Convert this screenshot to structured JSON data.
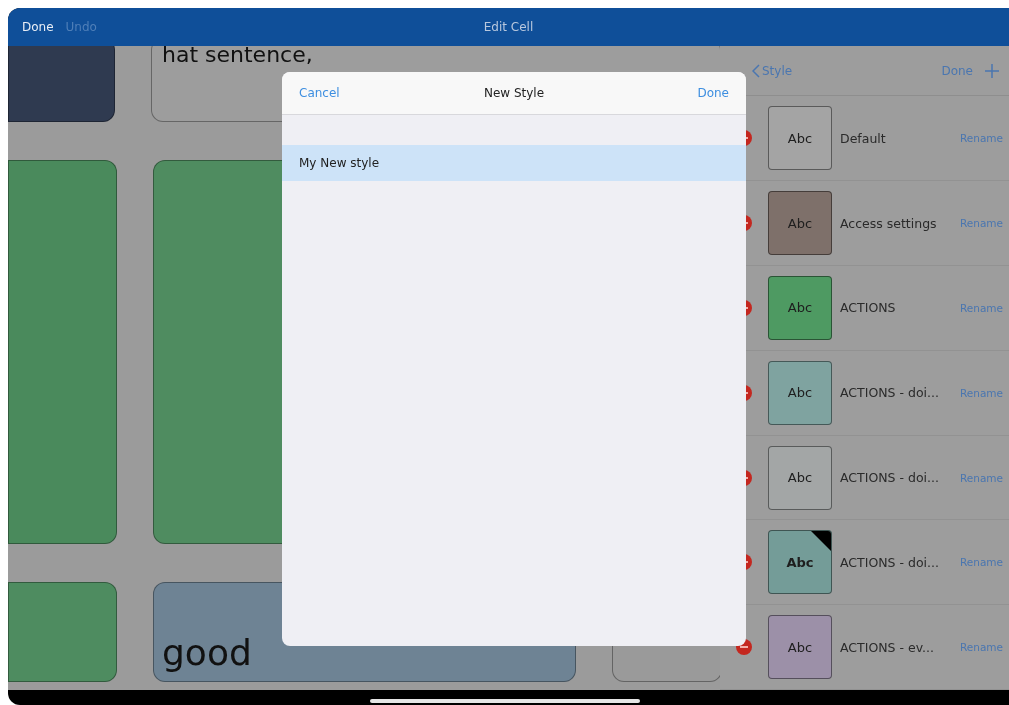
{
  "top_bar": {
    "done": "Done",
    "undo": {
      "label": "Undo",
      "disabled": true
    },
    "title": "Edit Cell"
  },
  "canvas": {
    "rows": [
      {
        "cells": [
          {
            "color": "#2f3a50",
            "text": ""
          },
          {
            "color": "#9d9d9d",
            "text": "hat sentence,"
          }
        ]
      },
      {
        "cells": [
          {
            "color": "#4a8a5c",
            "text": ""
          },
          {
            "color": "#4f8c60",
            "text": ""
          }
        ]
      },
      {
        "cells": [
          {
            "color": "#4e8c60",
            "text": ""
          },
          {
            "color": "#6e8394",
            "text": "good"
          },
          {
            "color": "#9a9a9a",
            "text": ""
          }
        ]
      }
    ]
  },
  "style_panel": {
    "back": "Style",
    "done": "Done",
    "styles": [
      {
        "name": "Default",
        "swatch": "Abc",
        "color": "#a4a4a4",
        "bold": false,
        "corner": false,
        "rename": "Rename"
      },
      {
        "name": "Access settings",
        "swatch": "Abc",
        "color": "#7e706a",
        "bold": false,
        "corner": false,
        "rename": "Rename"
      },
      {
        "name": "ACTIONS",
        "swatch": "Abc",
        "color": "#4e9a62",
        "bold": false,
        "corner": false,
        "rename": "Rename"
      },
      {
        "name": "ACTIONS - doi...",
        "swatch": "Abc",
        "color": "#7fa3a0",
        "bold": false,
        "corner": false,
        "rename": "Rename"
      },
      {
        "name": "ACTIONS - doi...",
        "swatch": "Abc",
        "color": "#a3a6a6",
        "bold": false,
        "corner": false,
        "rename": "Rename"
      },
      {
        "name": "ACTIONS - doi...",
        "swatch": "Abc",
        "color": "#749c98",
        "bold": true,
        "corner": true,
        "rename": "Rename"
      },
      {
        "name": "ACTIONS - ev...",
        "swatch": "Abc",
        "color": "#9c90a8",
        "bold": false,
        "corner": false,
        "rename": "Rename"
      }
    ]
  },
  "dialog": {
    "cancel": "Cancel",
    "title": "New Style",
    "done": "Done",
    "items": [
      {
        "label": "My New style",
        "selected": true
      }
    ]
  }
}
